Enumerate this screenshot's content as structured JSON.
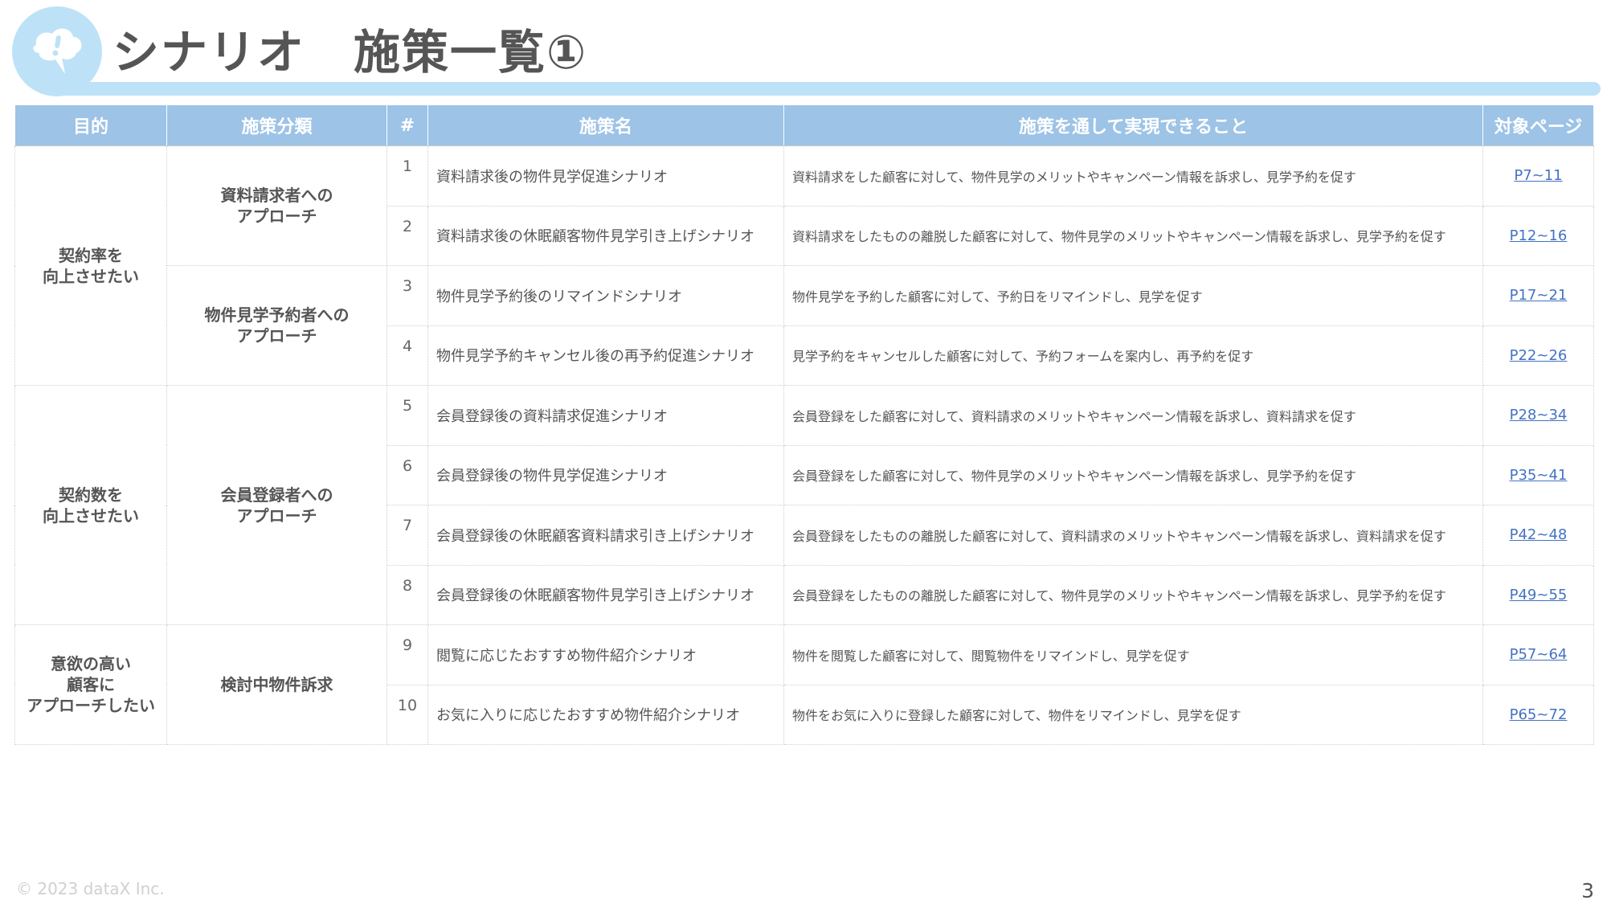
{
  "header": {
    "title": "シナリオ　施策一覧①",
    "icon": "speech-bubble-exclamation-icon",
    "accent_color": "#bde2f7"
  },
  "table": {
    "columns": [
      "目的",
      "施策分類",
      "#",
      "施策名",
      "施策を通して実現できること",
      "対象ページ"
    ],
    "header_color": "#9dc3e6",
    "groups": [
      {
        "goal": "契約率を\n向上させたい",
        "categories": [
          {
            "name": "資料請求者への\nアプローチ",
            "rows": [
              {
                "num": "1",
                "name": "資料請求後の物件見学促進シナリオ",
                "desc": "資料請求をした顧客に対して、物件見学のメリットやキャンペーン情報を訴求し、見学予約を促す",
                "page": "P7~11"
              },
              {
                "num": "2",
                "name": "資料請求後の休眠顧客物件見学引き上げシナリオ",
                "desc": "資料請求をしたものの離脱した顧客に対して、物件見学のメリットやキャンペーン情報を訴求し、見学予約を促す",
                "page": "P12~16"
              }
            ]
          },
          {
            "name": "物件見学予約者への\nアプローチ",
            "rows": [
              {
                "num": "3",
                "name": "物件見学予約後のリマインドシナリオ",
                "desc": "物件見学を予約した顧客に対して、予約日をリマインドし、見学を促す",
                "page": "P17~21"
              },
              {
                "num": "4",
                "name": "物件見学予約キャンセル後の再予約促進シナリオ",
                "desc": "見学予約をキャンセルした顧客に対して、予約フォームを案内し、再予約を促す",
                "page": "P22~26"
              }
            ]
          }
        ]
      },
      {
        "goal": "契約数を\n向上させたい",
        "categories": [
          {
            "name": "会員登録者への\nアプローチ",
            "rows": [
              {
                "num": "5",
                "name": "会員登録後の資料請求促進シナリオ",
                "desc": "会員登録をした顧客に対して、資料請求のメリットやキャンペーン情報を訴求し、資料請求を促す",
                "page": "P28~34"
              },
              {
                "num": "6",
                "name": "会員登録後の物件見学促進シナリオ",
                "desc": "会員登録をした顧客に対して、物件見学のメリットやキャンペーン情報を訴求し、見学予約を促す",
                "page": "P35~41"
              },
              {
                "num": "7",
                "name": "会員登録後の休眠顧客資料請求引き上げシナリオ",
                "desc": "会員登録をしたものの離脱した顧客に対して、資料請求のメリットやキャンペーン情報を訴求し、資料請求を促す",
                "page": "P42~48"
              },
              {
                "num": "8",
                "name": "会員登録後の休眠顧客物件見学引き上げシナリオ",
                "desc": "会員登録をしたものの離脱した顧客に対して、物件見学のメリットやキャンペーン情報を訴求し、見学予約を促す",
                "page": "P49~55"
              }
            ]
          }
        ]
      },
      {
        "goal": "意欲の高い\n顧客に\nアプローチしたい",
        "categories": [
          {
            "name": "検討中物件訴求",
            "rows": [
              {
                "num": "9",
                "name": "閲覧に応じたおすすめ物件紹介シナリオ",
                "desc": "物件を閲覧した顧客に対して、閲覧物件をリマインドし、見学を促す",
                "page": "P57~64"
              },
              {
                "num": "10",
                "name": "お気に入りに応じたおすすめ物件紹介シナリオ",
                "desc": "物件をお気に入りに登録した顧客に対して、物件をリマインドし、見学を促す",
                "page": "P65~72"
              }
            ]
          }
        ]
      }
    ]
  },
  "footer": {
    "copyright": "© 2023 dataX Inc.",
    "page_number": "3"
  }
}
